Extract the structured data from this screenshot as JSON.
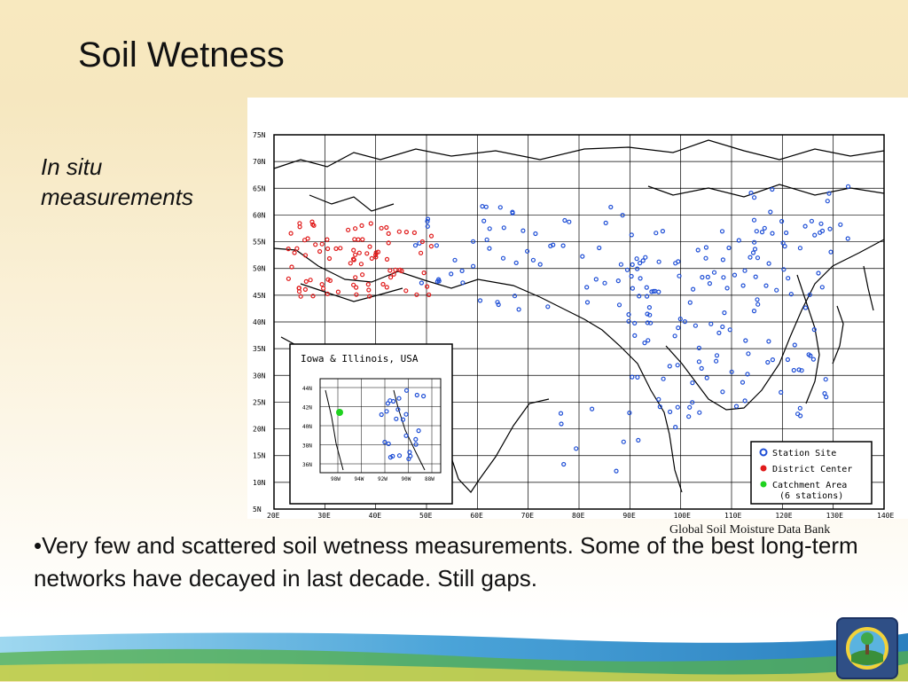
{
  "slide": {
    "title": "Soil Wetness",
    "subtitle": "In situ measurements",
    "bullet": "•Very few and scattered soil wetness measurements.  Some of the best long-term networks have decayed in last decade.  Still gaps.",
    "source": "Global Soil Moisture Data Bank"
  },
  "map": {
    "lat_labels": [
      "75N",
      "70N",
      "65N",
      "60N",
      "55N",
      "50N",
      "45N",
      "40N",
      "35N",
      "30N",
      "25N",
      "20N",
      "15N",
      "10N",
      "5N"
    ],
    "lon_labels": [
      "20E",
      "30E",
      "40E",
      "50E",
      "60E",
      "70E",
      "80E",
      "90E",
      "100E",
      "110E",
      "120E",
      "130E",
      "140E"
    ],
    "inset": {
      "title": "Iowa & Illinois, USA",
      "lat_labels": [
        "44N",
        "42N",
        "40N",
        "38N",
        "36N"
      ],
      "lon_labels": [
        "98W",
        "94W",
        "92W",
        "90W",
        "88W"
      ]
    },
    "legend": [
      {
        "label": "Station Site",
        "color": "#1f4fd6"
      },
      {
        "label": "District Center",
        "color": "#e01b1b"
      },
      {
        "label": "Catchment Area",
        "color": "#1fd21f",
        "note": "(6 stations)"
      }
    ],
    "colors": {
      "station": "#1f4fd6",
      "district": "#e01b1b",
      "catchment": "#1fd21f",
      "background": "#f6e7bf"
    }
  }
}
